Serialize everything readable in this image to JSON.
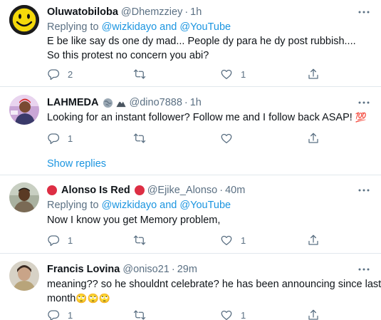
{
  "tweets": [
    {
      "name": "Oluwatobiloba",
      "handle": "@Dhemzziey",
      "dot": "·",
      "time": "1h",
      "replying_prefix": "Replying to ",
      "replying_to": "@wizkidayo and @YouTube",
      "text": "E be like say ds one dy mad... People dy para he dy post rubbish.... So this protest no concern you abi?",
      "reply_count": "2",
      "retweet_count": "",
      "like_count": "1"
    },
    {
      "name": "LAHMEDA",
      "handle": "@dino7888",
      "dot": "·",
      "time": "1h",
      "text": "Looking for an instant follower? Follow me and I follow back ASAP!",
      "emoji": "💯",
      "reply_count": "1",
      "retweet_count": "",
      "like_count": ""
    },
    {
      "name": "Alonso Is Red",
      "handle": "@Ejike_Alonso",
      "dot": "·",
      "time": "40m",
      "replying_prefix": "Replying to ",
      "replying_to": "@wizkidayo and @YouTube",
      "text": "Now I know you get Memory problem,",
      "reply_count": "1",
      "retweet_count": "",
      "like_count": "1"
    },
    {
      "name": "Francis Lovina",
      "handle": "@oniso21",
      "dot": "·",
      "time": "29m",
      "text_line1": "meaning?? so he shouldnt celebrate? he has been announcing since last",
      "text_line2": "month",
      "emoji": "🙄🙄🙄",
      "reply_count": "1",
      "retweet_count": "",
      "like_count": "1"
    }
  ],
  "show_replies": "Show replies",
  "colors": {
    "link": "#1b95e0",
    "muted": "#5b7083",
    "divider": "#e1e8ed",
    "red": "#dd2e44"
  },
  "icons": [
    "reply-icon",
    "retweet-icon",
    "like-icon",
    "share-icon",
    "more-icon"
  ]
}
